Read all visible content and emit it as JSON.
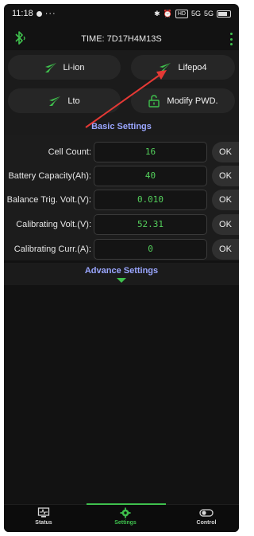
{
  "status_bar": {
    "time": "11:18",
    "more": "···",
    "net_chip": "HD",
    "sig1": "5G",
    "sig2": "5G"
  },
  "header": {
    "title": "TIME: 7D17H4M13S"
  },
  "modes": [
    {
      "label": "Li-ion"
    },
    {
      "label": "Lifepo4"
    },
    {
      "label": "Lto"
    },
    {
      "label": "Modify PWD."
    }
  ],
  "basic_settings": {
    "title": "Basic Settings",
    "rows": [
      {
        "label": "Cell Count:",
        "value": "16",
        "ok": "OK"
      },
      {
        "label": "Battery Capacity(Ah):",
        "value": "40",
        "ok": "OK"
      },
      {
        "label": "Balance Trig. Volt.(V):",
        "value": "0.010",
        "ok": "OK"
      },
      {
        "label": "Calibrating Volt.(V):",
        "value": "52.31",
        "ok": "OK"
      },
      {
        "label": "Calibrating Curr.(A):",
        "value": "0",
        "ok": "OK"
      }
    ]
  },
  "advance_settings": {
    "title": "Advance Settings"
  },
  "nav": [
    {
      "label": "Status"
    },
    {
      "label": "Settings"
    },
    {
      "label": "Control"
    }
  ],
  "colors": {
    "accent": "#3fc04d",
    "section_title": "#9aa6ff",
    "value_text": "#54d05c",
    "annotation_arrow": "#e53935"
  }
}
